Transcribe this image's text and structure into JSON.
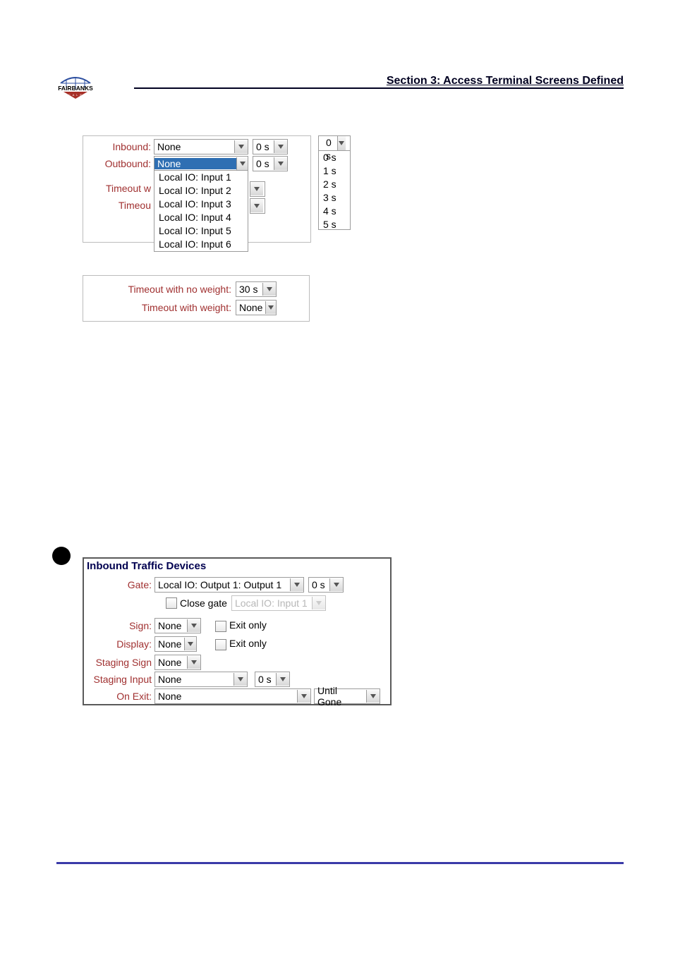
{
  "header": {
    "section_title": "Section 3:  Access Terminal Screens Defined",
    "logo_top": "FAIRBANKS"
  },
  "panel_inout": {
    "inbound_label": "Inbound:",
    "inbound_value": "None",
    "inbound_sec": "0 s",
    "outbound_label": "Outbound:",
    "outbound_value": "None",
    "outbound_sec": "0 s",
    "timeout_no_wt_label": "Timeout w",
    "timeout_wt_label": "Timeou",
    "io_options": [
      "Local IO: Input 1",
      "Local IO: Input 2",
      "Local IO: Input 3",
      "Local IO: Input 4",
      "Local IO: Input 5",
      "Local IO: Input 6"
    ]
  },
  "second_options": [
    "0 s",
    "1 s",
    "2 s",
    "3 s",
    "4 s",
    "5 s"
  ],
  "panel_timeout": {
    "no_weight_label": "Timeout with no weight:",
    "no_weight_value": "30 s",
    "weight_label": "Timeout with weight:",
    "weight_value": "None"
  },
  "panel_itd": {
    "title": "Inbound Traffic Devices",
    "gate_label": "Gate:",
    "gate_value": "Local IO: Output 1: Output 1",
    "gate_sec": "0 s",
    "close_gate_label": "Close gate",
    "close_gate_value": "Local IO: Input 1",
    "sign_label": "Sign:",
    "sign_value": "None",
    "sign_exit_label": "Exit only",
    "display_label": "Display:",
    "display_value": "None",
    "display_exit_label": "Exit only",
    "staging_sign_label": "Staging Sign",
    "staging_sign_value": "None",
    "staging_input_label": "Staging Input",
    "staging_input_value": "None",
    "staging_input_sec": "0 s",
    "onexit_label": "On Exit:",
    "onexit_value": "None",
    "onexit_until": "Until Gone"
  }
}
